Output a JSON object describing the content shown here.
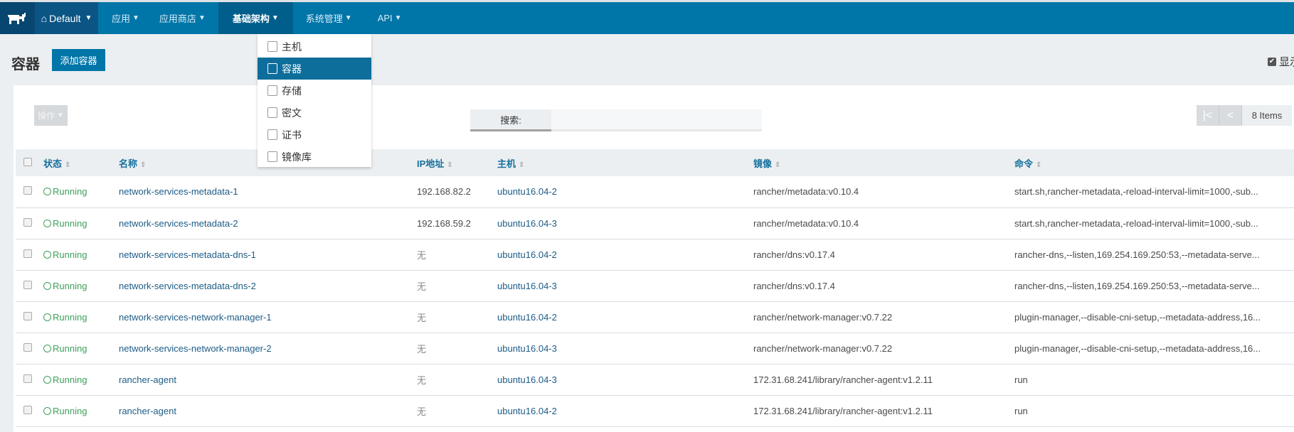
{
  "nav": {
    "env": "Default",
    "items": [
      {
        "label": "应用"
      },
      {
        "label": "应用商店"
      },
      {
        "label": "基础架构",
        "active": true
      },
      {
        "label": "系统管理"
      },
      {
        "label": "API"
      }
    ]
  },
  "dropdown": {
    "items": [
      {
        "label": "主机",
        "icon": "server-icon"
      },
      {
        "label": "容器",
        "icon": "cube-icon",
        "selected": true
      },
      {
        "label": "存储",
        "icon": "storage-icon"
      },
      {
        "label": "密文",
        "icon": "secret-icon"
      },
      {
        "label": "证书",
        "icon": "certificate-icon"
      },
      {
        "label": "镜像库",
        "icon": "registry-icon"
      }
    ]
  },
  "page": {
    "title": "容器",
    "add_button": "添加容器",
    "show_label": "显示"
  },
  "toolbar": {
    "actions_label": "操作",
    "search_label": "搜索:",
    "search_value": "",
    "count": "8 Items"
  },
  "table": {
    "headers": [
      "状态",
      "名称",
      "IP地址",
      "主机",
      "镜像",
      "命令"
    ],
    "rows": [
      {
        "state": "Running",
        "name": "network-services-metadata-1",
        "ip": "192.168.82.2",
        "host": "ubuntu16.04-2",
        "image": "rancher/metadata:v0.10.4",
        "command": "start.sh,rancher-metadata,-reload-interval-limit=1000,-sub..."
      },
      {
        "state": "Running",
        "name": "network-services-metadata-2",
        "ip": "192.168.59.2",
        "host": "ubuntu16.04-3",
        "image": "rancher/metadata:v0.10.4",
        "command": "start.sh,rancher-metadata,-reload-interval-limit=1000,-sub..."
      },
      {
        "state": "Running",
        "name": "network-services-metadata-dns-1",
        "ip": "无",
        "host": "ubuntu16.04-2",
        "image": "rancher/dns:v0.17.4",
        "command": "rancher-dns,--listen,169.254.169.250:53,--metadata-serve..."
      },
      {
        "state": "Running",
        "name": "network-services-metadata-dns-2",
        "ip": "无",
        "host": "ubuntu16.04-3",
        "image": "rancher/dns:v0.17.4",
        "command": "rancher-dns,--listen,169.254.169.250:53,--metadata-serve..."
      },
      {
        "state": "Running",
        "name": "network-services-network-manager-1",
        "ip": "无",
        "host": "ubuntu16.04-2",
        "image": "rancher/network-manager:v0.7.22",
        "command": "plugin-manager,--disable-cni-setup,--metadata-address,16..."
      },
      {
        "state": "Running",
        "name": "network-services-network-manager-2",
        "ip": "无",
        "host": "ubuntu16.04-3",
        "image": "rancher/network-manager:v0.7.22",
        "command": "plugin-manager,--disable-cni-setup,--metadata-address,16..."
      },
      {
        "state": "Running",
        "name": "rancher-agent",
        "ip": "无",
        "host": "ubuntu16.04-3",
        "image": "172.31.68.241/library/rancher-agent:v1.2.11",
        "command": "run"
      },
      {
        "state": "Running",
        "name": "rancher-agent",
        "ip": "无",
        "host": "ubuntu16.04-2",
        "image": "172.31.68.241/library/rancher-agent:v1.2.11",
        "command": "run"
      }
    ]
  },
  "colors": {
    "nav": "#0075a8",
    "accent": "#0075a8",
    "running": "#3ea05a"
  }
}
